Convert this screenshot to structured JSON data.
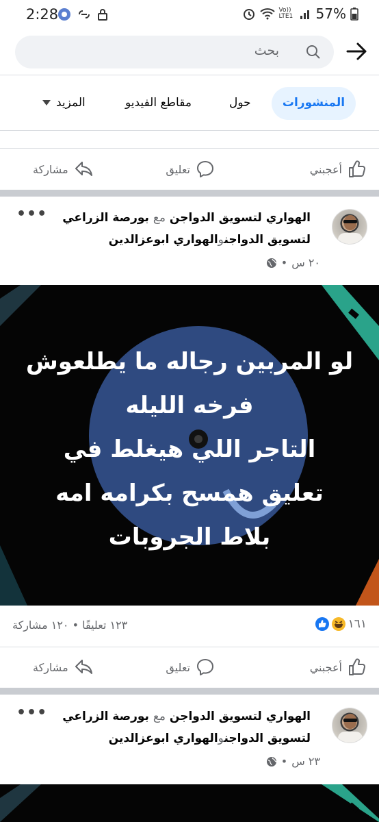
{
  "status_bar": {
    "time": "2:28",
    "battery": "57%",
    "network": "Vo)) LTE1",
    "icons": [
      "app-circle-icon",
      "link-icon",
      "lock-icon",
      "alarm-icon",
      "wifi-icon",
      "signal-icon",
      "battery-icon"
    ]
  },
  "search": {
    "placeholder": "بحث"
  },
  "tabs": {
    "posts": "المنشورات",
    "about": "حول",
    "videos": "مقاطع الفيديو",
    "more": "المزيد"
  },
  "actions": {
    "like": "أعجبني",
    "comment": "تعليق",
    "share": "مشاركة"
  },
  "posts": [
    {
      "author": "الهواري لتسويق الدواجن",
      "with_word": "مع",
      "partner_1": "بورصة الزراعي",
      "partner_2": "لتسويق الدواجن",
      "and_word": "و",
      "partner_3": "الهواري ابوعزالدين",
      "time": "٢٠ س",
      "sep": "•",
      "image_text": [
        "لو المربين رجاله ما يطلعوش",
        "فرخه الليله",
        "التاجر اللي هيغلط في",
        "تعليق همسح بكرامه امه",
        "بلاط الجروبات"
      ],
      "reactions_count": "١٦١",
      "comments_shares": "١٢٣ تعليقًا • ١٢٠ مشاركة"
    },
    {
      "author": "الهواري لتسويق الدواجن",
      "with_word": "مع",
      "partner_1": "بورصة الزراعي",
      "partner_2": "لتسويق الدواجن",
      "and_word": "و",
      "partner_3": "الهواري ابوعزالدين",
      "time": "٢٣ س",
      "sep": "•"
    }
  ],
  "colors": {
    "accent": "#1877f2",
    "tab_active_bg": "#e7f3ff",
    "separator": "#c9ccd1",
    "image_circle": "#2f4a80"
  }
}
